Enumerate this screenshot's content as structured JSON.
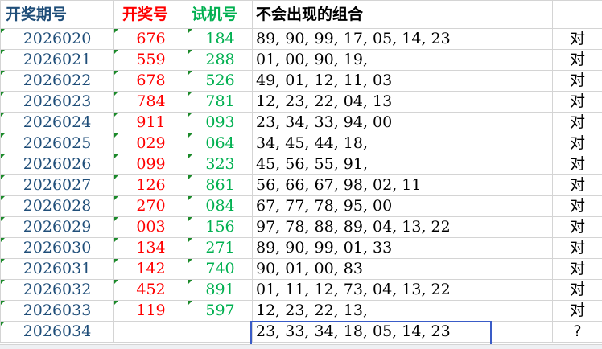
{
  "headers": {
    "period": "开奖期号",
    "draw": "开奖号",
    "test": "试机号",
    "combo": "不会出现的组合",
    "result": ""
  },
  "rows": [
    {
      "period": "2026020",
      "draw": "676",
      "test": "184",
      "combo": "89, 90, 99, 17, 05, 14, 23",
      "result": "对"
    },
    {
      "period": "2026021",
      "draw": "559",
      "test": "288",
      "combo": "01, 00, 90, 19,",
      "result": "对"
    },
    {
      "period": "2026022",
      "draw": "678",
      "test": "526",
      "combo": "49, 01, 12, 11, 03",
      "result": "对"
    },
    {
      "period": "2026023",
      "draw": "784",
      "test": "781",
      "combo": "12, 23, 22, 04, 13",
      "result": "对"
    },
    {
      "period": "2026024",
      "draw": "911",
      "test": "093",
      "combo": "23, 34, 33, 94, 00",
      "result": "对"
    },
    {
      "period": "2026025",
      "draw": "029",
      "test": "064",
      "combo": "34, 45, 44, 18,",
      "result": "对"
    },
    {
      "period": "2026026",
      "draw": "099",
      "test": "323",
      "combo": "45, 56, 55, 91,",
      "result": "对"
    },
    {
      "period": "2026027",
      "draw": "126",
      "test": "861",
      "combo": "56, 66, 67,  98, 02, 11",
      "result": "对"
    },
    {
      "period": "2026028",
      "draw": "270",
      "test": "084",
      "combo": "67, 77, 78, 95, 00",
      "result": "对"
    },
    {
      "period": "2026029",
      "draw": "003",
      "test": "156",
      "combo": "97, 78, 88, 89, 04, 13, 22",
      "result": "对"
    },
    {
      "period": "2026030",
      "draw": "134",
      "test": "271",
      "combo": "89, 90, 99, 01, 33",
      "result": "对"
    },
    {
      "period": "2026031",
      "draw": "142",
      "test": "740",
      "combo": "90, 01, 00, 83",
      "result": "对"
    },
    {
      "period": "2026032",
      "draw": "452",
      "test": "891",
      "combo": "01, 11, 12, 73, 04, 13, 22",
      "result": "对"
    },
    {
      "period": "2026033",
      "draw": "119",
      "test": "597",
      "combo": "12, 23, 22, 13,",
      "result": "对"
    },
    {
      "period": "2026034",
      "draw": "",
      "test": "",
      "combo": "23, 33, 34, 18, 05, 14, 23",
      "result": "?"
    }
  ],
  "colors": {
    "period": "#1f4e79",
    "draw": "#ff0000",
    "test": "#00b050",
    "selection": "#3a5cc7",
    "comment_marker": "#1b8a2a"
  }
}
